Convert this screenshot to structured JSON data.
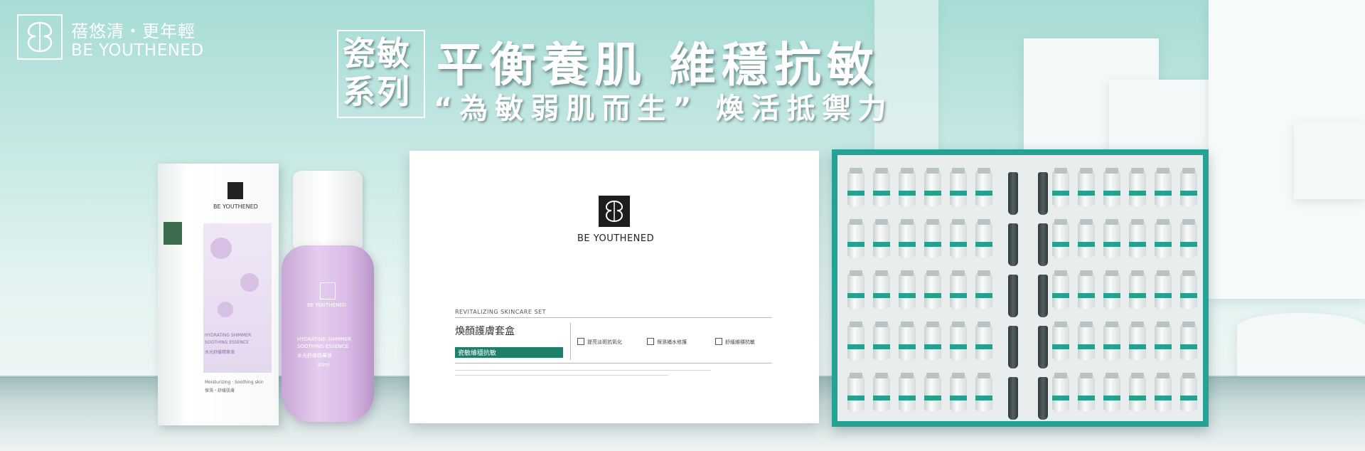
{
  "brand": {
    "name_cn": "蓓悠清・更年輕",
    "name_en": "BE YOUTHENED",
    "logo_icon": "butterfly-monogram-icon"
  },
  "headline": {
    "series_label": "瓷敏系列",
    "series_line1": "瓷敏",
    "series_line2": "系列",
    "main": "平衡養肌 維穩抗敏",
    "sub": "“為敏弱肌而生” 煥活抵禦力"
  },
  "products": {
    "essence": {
      "carton_brand": "BE YOUTHENED",
      "bottle_brand": "BE YOUTHENED",
      "name_en_1": "HYDRATING SHIMMER",
      "name_en_2": "SOOTHING ESSENCE",
      "name_cn": "水光舒緩精華液",
      "tagline_en": "Moisturizing · Soothing skin",
      "tagline_cn": "保濕・舒緩肌膚",
      "volume": "30ml"
    },
    "giftbox": {
      "brand": "BE YOUTHENED",
      "set_en": "REVITALIZING SKINCARE SET",
      "set_cn": "煥顏護膚套盒",
      "bar_label": "瓷敏維穩抗敏",
      "features": [
        "提亮淡斑抗氧化",
        "保濕補水修護",
        "舒緩維穩抗敏"
      ]
    }
  },
  "colors": {
    "teal": "#24a294",
    "lavender": "#dcc3ea",
    "background": "#c4e7e2"
  }
}
